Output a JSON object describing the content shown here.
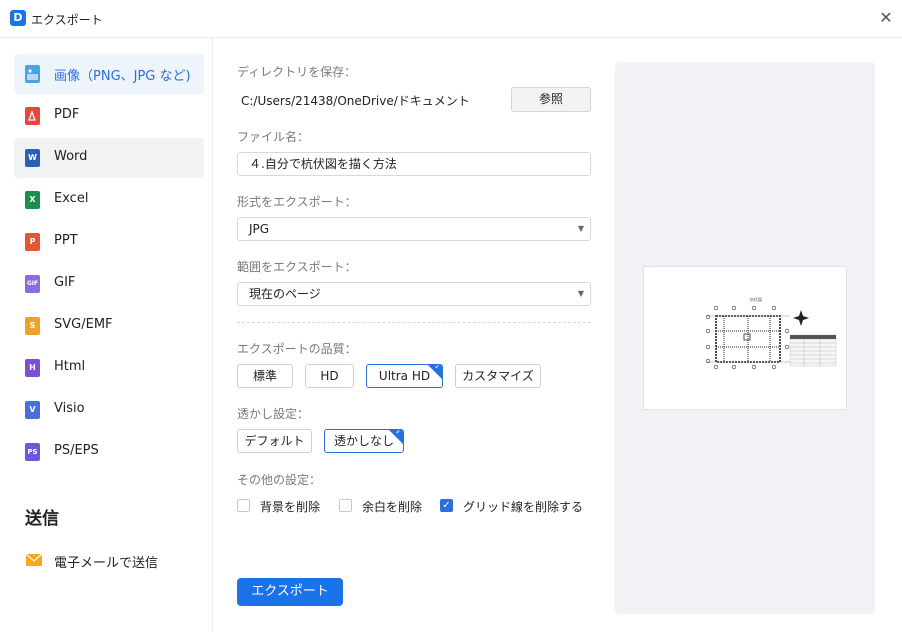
{
  "window": {
    "title": "エクスポート",
    "app_icon": "D"
  },
  "sidebar": {
    "items": [
      {
        "label": "画像（PNG、JPG など)",
        "icon": "image-icon",
        "color": "#4aa3df",
        "glyph": ""
      },
      {
        "label": "PDF",
        "icon": "pdf-icon",
        "color": "#e8453c",
        "glyph": ""
      },
      {
        "label": "Word",
        "icon": "word-icon",
        "color": "#2b5fb4",
        "glyph": "W"
      },
      {
        "label": "Excel",
        "icon": "excel-icon",
        "color": "#1e8e4e",
        "glyph": "X"
      },
      {
        "label": "PPT",
        "icon": "ppt-icon",
        "color": "#e2572e",
        "glyph": "P"
      },
      {
        "label": "GIF",
        "icon": "gif-icon",
        "color": "#8b6be0",
        "glyph": "GIF"
      },
      {
        "label": "SVG/EMF",
        "icon": "svg-icon",
        "color": "#f0a12b",
        "glyph": "S"
      },
      {
        "label": "Html",
        "icon": "html-icon",
        "color": "#7b4fd4",
        "glyph": "H"
      },
      {
        "label": "Visio",
        "icon": "visio-icon",
        "color": "#4a6fd8",
        "glyph": "V"
      },
      {
        "label": "PS/EPS",
        "icon": "ps-icon",
        "color": "#6a5ad8",
        "glyph": "PS"
      }
    ],
    "send_heading": "送信",
    "mail_label": "電子メールで送信"
  },
  "form": {
    "dir_label": "ディレクトリを保存：",
    "dir_path": "C:/Users/21438/OneDrive/ドキュメント",
    "browse_label": "参照",
    "filename_label": "ファイル名：",
    "filename_value": "４.自分で杭伏図を描く方法",
    "format_label": "形式をエクスポート：",
    "format_value": "JPG",
    "range_label": "範囲をエクスポート：",
    "range_value": "現在のページ",
    "quality_label": "エクスポートの品質：",
    "quality_options": [
      "標準",
      "HD",
      "Ultra HD",
      "カスタマイズ"
    ],
    "watermark_label": "透かし設定：",
    "watermark_options": [
      "デフォルト",
      "透かしなし"
    ],
    "other_label": "その他の設定：",
    "other_options": [
      "背景を削除",
      "余白を削除",
      "グリッド線を削除する"
    ],
    "export_label": "エクスポート"
  },
  "preview": {
    "drawing_title": "杭伏図"
  },
  "colors": {
    "accent": "#1a73e8",
    "selected_bg": "#eef4fc"
  }
}
